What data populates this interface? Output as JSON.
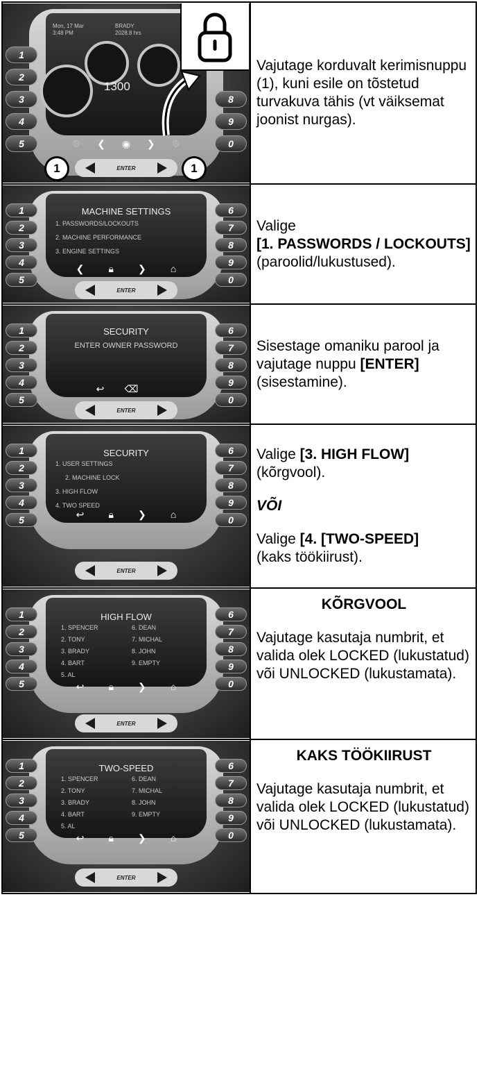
{
  "keys_left": [
    "1",
    "2",
    "3",
    "4",
    "5"
  ],
  "keys_right_row1": [
    "8",
    "9",
    "0"
  ],
  "keys_right": [
    "6",
    "7",
    "8",
    "9",
    "0"
  ],
  "enter_label": "ENTER",
  "callout_number": "1",
  "row1": {
    "screen": {
      "date": "Mon, 17 Mar",
      "time": "3:48 PM",
      "user": "BRADY",
      "hours": "2028.8 hrs",
      "reading": "1300"
    },
    "text": "Vajutage korduvalt kerimisnuppu (1), kuni esile on tõstetud turvakuva tähis (vt väiksemat joonist nurgas)."
  },
  "row2": {
    "screen": {
      "title": "MACHINE SETTINGS",
      "lines": [
        "1. PASSWORDS/LOCKOUTS",
        "2. MACHINE PERFORMANCE",
        "3. ENGINE SETTINGS"
      ]
    },
    "text_a": "Valige",
    "text_b": "[1. PASSWORDS / LOCKOUTS]",
    "text_c": "(paroolid/lukustused)."
  },
  "row3": {
    "screen": {
      "title": "SECURITY",
      "prompt": "ENTER OWNER PASSWORD"
    },
    "text_a": "Sisestage omaniku parool ja vajutage nuppu",
    "text_b": "[ENTER]",
    "text_c": "(sisestamine)."
  },
  "row4": {
    "screen": {
      "title": "SECURITY",
      "lines": [
        "1. USER SETTINGS",
        "2. MACHINE LOCK",
        "3. HIGH FLOW",
        "4. TWO SPEED"
      ]
    },
    "text_a": "Valige",
    "text_b": "[3. HIGH FLOW]",
    "text_c": "(kõrgvool).",
    "or": "VÕI",
    "text_d": "Valige",
    "text_e": "[4. [TWO-SPEED]",
    "text_f": "(kaks töökiirust)."
  },
  "row5": {
    "screen": {
      "title": "HIGH FLOW",
      "col1": [
        "1. SPENCER",
        "2. TONY",
        "3. BRADY",
        "4. BART",
        "5. AL"
      ],
      "col2": [
        "6. DEAN",
        "7. MICHAL",
        "8. JOHN",
        "9. EMPTY"
      ]
    },
    "heading": "KÕRGVOOL",
    "text": "Vajutage kasutaja numbrit, et valida olek LOCKED (lukustatud) või UNLOCKED (lukustamata)."
  },
  "row6": {
    "screen": {
      "title": "TWO-SPEED",
      "col1": [
        "1. SPENCER",
        "2. TONY",
        "3. BRADY",
        "4. BART",
        "5. AL"
      ],
      "col2": [
        "6. DEAN",
        "7. MICHAL",
        "8. JOHN",
        "9. EMPTY"
      ]
    },
    "heading": "KAKS TÖÖKIIRUST",
    "text": "Vajutage kasutaja numbrit, et valida olek LOCKED (lukustatud) või UNLOCKED (lukustamata)."
  }
}
